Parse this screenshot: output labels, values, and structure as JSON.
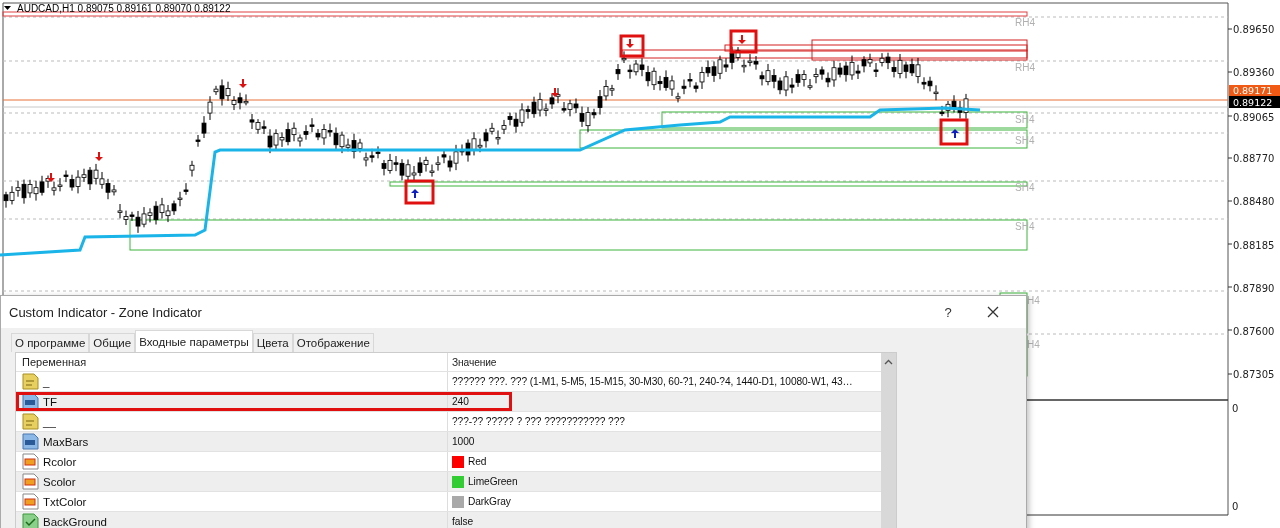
{
  "chart": {
    "title": "AUDCAD,H1  0.89075 0.89161 0.89070 0.89122",
    "price_labels": [
      "0.89650",
      "0.89360",
      "0.89065",
      "0.88770",
      "0.88480",
      "0.88185",
      "0.87890",
      "0.87600",
      "0.87305"
    ],
    "bid_tag": "0.89171",
    "last_tag": "0.89122",
    "zone_labels": [
      "RH4",
      "RH4",
      "SH4",
      "SH4",
      "SH4",
      "SH4",
      "H4",
      "H4"
    ],
    "subwindow_labels": [
      "0",
      "0"
    ]
  },
  "dialog": {
    "title": "Custom Indicator - Zone Indicator",
    "help": "?",
    "tabs": [
      {
        "label": "О программе",
        "selected": false
      },
      {
        "label": "Общие",
        "selected": false
      },
      {
        "label": "Входные параметры",
        "selected": true
      },
      {
        "label": "Цвета",
        "selected": false
      },
      {
        "label": "Отображение",
        "selected": false
      }
    ],
    "columns": [
      "Переменная",
      "Значение"
    ],
    "rows": [
      {
        "kind": "string",
        "name": "_",
        "value": "?????? ???. ??? (1-M1, 5-M5, 15-M15, 30-M30, 60-?1, 240-?4, 1440-D1, 10080-W1, 43…",
        "highlighted": false
      },
      {
        "kind": "int",
        "name": "TF",
        "value": "240",
        "highlighted": true
      },
      {
        "kind": "string",
        "name": "__",
        "value": "???-?? ????? ? ??? ??????????? ???",
        "highlighted": false
      },
      {
        "kind": "int",
        "name": "MaxBars",
        "value": "1000",
        "highlighted": false
      },
      {
        "kind": "color",
        "name": "Rcolor",
        "value": "Red",
        "color": "#ff0000",
        "highlighted": false
      },
      {
        "kind": "color",
        "name": "Scolor",
        "value": "LimeGreen",
        "color": "#32cd32",
        "highlighted": false
      },
      {
        "kind": "color",
        "name": "TxtColor",
        "value": "DarkGray",
        "color": "#a9a9a9",
        "highlighted": false
      },
      {
        "kind": "bool",
        "name": "BackGround",
        "value": "false",
        "highlighted": false
      }
    ]
  }
}
